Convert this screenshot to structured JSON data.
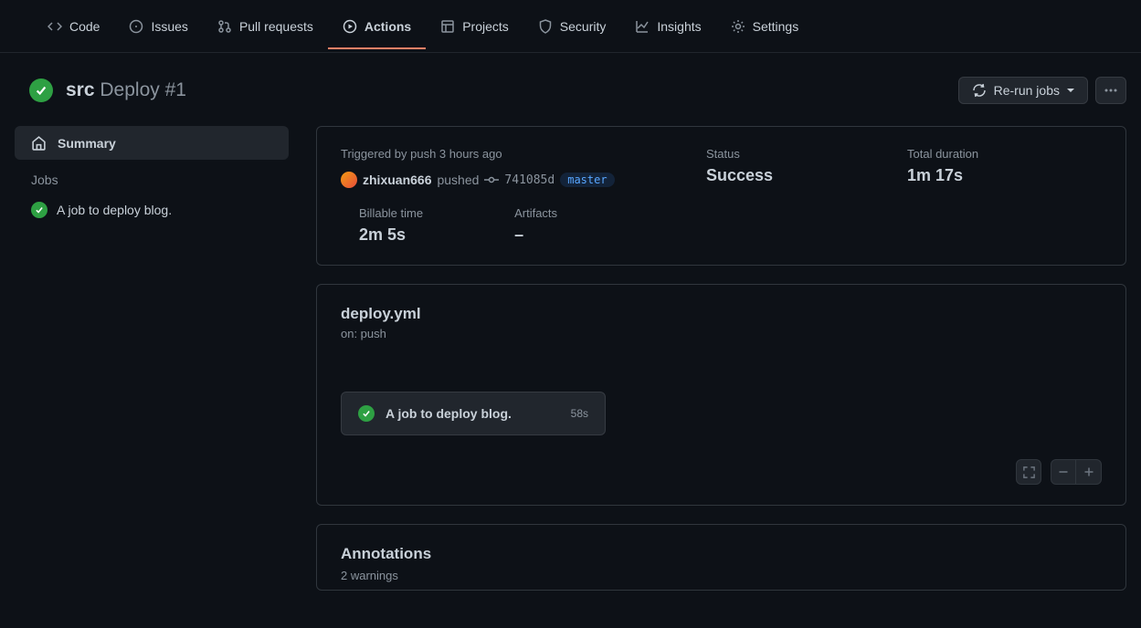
{
  "nav": {
    "code": "Code",
    "issues": "Issues",
    "pulls": "Pull requests",
    "actions": "Actions",
    "projects": "Projects",
    "security": "Security",
    "insights": "Insights",
    "settings": "Settings"
  },
  "header": {
    "src": "src",
    "title": "Deploy #1",
    "rerun": "Re-run jobs"
  },
  "sidebar": {
    "summary": "Summary",
    "jobs_label": "Jobs",
    "job0": "A job to deploy blog."
  },
  "meta": {
    "trigger_label": "Triggered by push 3 hours ago",
    "user": "zhixuan666",
    "pushed": "pushed",
    "sha": "741085d",
    "branch": "master",
    "status_label": "Status",
    "status_val": "Success",
    "duration_label": "Total duration",
    "duration_val": "1m 17s",
    "billable_label": "Billable time",
    "billable_val": "2m 5s",
    "artifacts_label": "Artifacts",
    "artifacts_val": "–"
  },
  "workflow": {
    "name": "deploy.yml",
    "on": "on: push",
    "job_name": "A job to deploy blog.",
    "job_time": "58s"
  },
  "annotations": {
    "title": "Annotations",
    "sub": "2 warnings"
  }
}
